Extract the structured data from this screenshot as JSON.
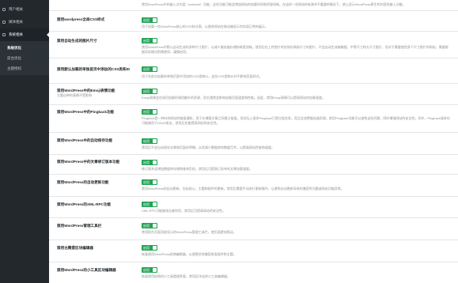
{
  "sidebar": {
    "items": [
      {
        "label": "用户相关",
        "active": false
      },
      {
        "label": "媒体相关",
        "active": false
      },
      {
        "label": "系统相关",
        "active": true
      }
    ],
    "submenu": [
      {
        "label": "系统优化",
        "current": true
      },
      {
        "label": "前台优化",
        "current": false
      },
      {
        "label": "主题授权",
        "current": false
      }
    ]
  },
  "settings": [
    {
      "label": "",
      "sub": "",
      "toggle": "",
      "desc": "禁用WordPress中的嵌入式内容（embeds）功能，这些功能可能会增加网站的加载时间和资源消耗。在这样一些网站的来源并不重要的情况下，禁止显示WordPress原生的内容的嵌入功能。"
    },
    {
      "label": "禁用wordpress全局CSS样式",
      "sub": "",
      "toggle": "启用",
      "desc": "用于加载一些WordPress核心的CSS样式表，以便其网站在移动端显示时实现正常的展示。"
    },
    {
      "label": "禁用自动生成的图片尺寸",
      "sub": "",
      "toggle": "启用",
      "desc": "禁用WordPress中默认自动生成的多种尺寸图片，以减少服务器存储和带宽消耗。禁用后在上传图片时仅保存原始尺寸的图片，不会自动生成缩略图、中等尺寸和大尺寸图片，但对于需要使用多个尺寸图片的网站，需要根据实际情况酌情使用，谨慎启用。"
    },
    {
      "label": "禁用默认加载的单独首页中添加的CSS类和ID",
      "sub": "",
      "toggle": "启用",
      "desc": "用于在前台加载的单独页面中添加的CSS类和ID，这些CSS类和ID并不影响页面样式。"
    },
    {
      "label": "禁用WordPress中的Emoji表情功能",
      "sub": "主题自带的表情不受影响",
      "toggle": "启用",
      "desc": "Emoji表情会在网页加载时调用额外的资源，而它通常会影响加载页面速度和性能。因此，禁用Emoji表情可以提高网站的加载速度。"
    },
    {
      "label": "禁用WordPress中的Pingback功能",
      "sub": "",
      "toggle": "启用",
      "desc": "Pingback是一种向你网站的链接通知，用于在博客文章之间建立链接。但实际上很多Pingback只是垃圾信息，而且会浪费服务器资源。禁用Pingback功能可以避免这些问题，同时增强网站的安全性。另外，Pingback请求也可能被用于DDoS攻击，禁用后也能提高网站的安全性。"
    },
    {
      "label": "禁用WordPress中的自动保存功能",
      "sub": "",
      "toggle": "启用",
      "desc": "禁用后不会自动保存文章和页面的草稿，从而减少数据库的数据冗余，以提高网站性能和速度。"
    },
    {
      "label": "禁用WordPress中的文章修订版本功能",
      "sub": "",
      "toggle": "启用",
      "desc": "修订版本会增加数据库存储和查询负担，禁用后可提高已发布的文章加载速度。"
    },
    {
      "label": "禁用WordPress的自动更新功能",
      "sub": "",
      "toggle": "启用",
      "desc": "禁用WordPress的自动更新，包括核心、主题和插件的更新。禁用后需要手动进行更新操作，以避免自动更新导致的兼容性问题或网站功能异常。"
    },
    {
      "label": "禁用WordPress的XML-RPC功能",
      "sub": "",
      "toggle": "启用",
      "desc": "XML-RPC可能被攻击者利用，禁用后可提高网站的安全性。"
    },
    {
      "label": "禁用WordPress管理工具栏",
      "sub": "",
      "toggle": "启用",
      "desc": "禁用前台页面顶部显示的WordPress管理工具栏，使页面更加简洁。"
    },
    {
      "label": "禁用古腾堡区块编辑器",
      "sub": "",
      "toggle": "启用",
      "desc": "恢复使用WordPress经典编辑器，以便更好地兼容各类插件和主题。"
    },
    {
      "label": "禁用WordPress的小工具区块编辑器",
      "sub": "",
      "toggle": "启用",
      "desc": "恢复使用经典的小工具管理界面，禁用区块化的小工具编辑器。"
    }
  ]
}
